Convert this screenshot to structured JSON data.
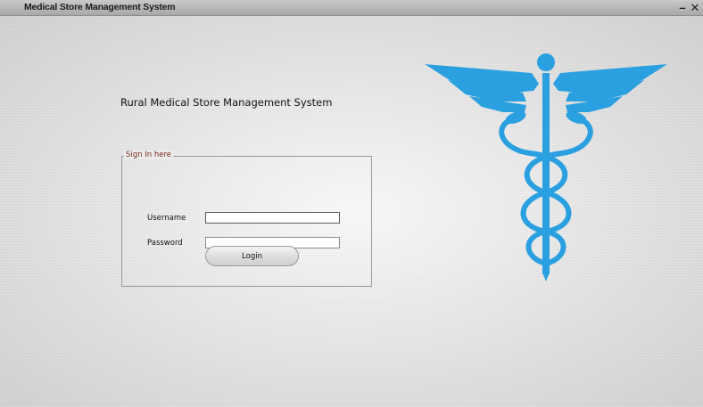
{
  "window": {
    "title": "Medical Store Management System",
    "minimize_glyph": "–",
    "close_glyph": "✕"
  },
  "main": {
    "heading": "Rural Medical Store Management System"
  },
  "signin": {
    "legend": "Sign In here",
    "username_label": "Username",
    "password_label": "Password",
    "username_value": "",
    "password_value": "",
    "login_label": "Login"
  },
  "logo": {
    "icon": "caduceus-icon",
    "color": "#2ba0e0"
  }
}
